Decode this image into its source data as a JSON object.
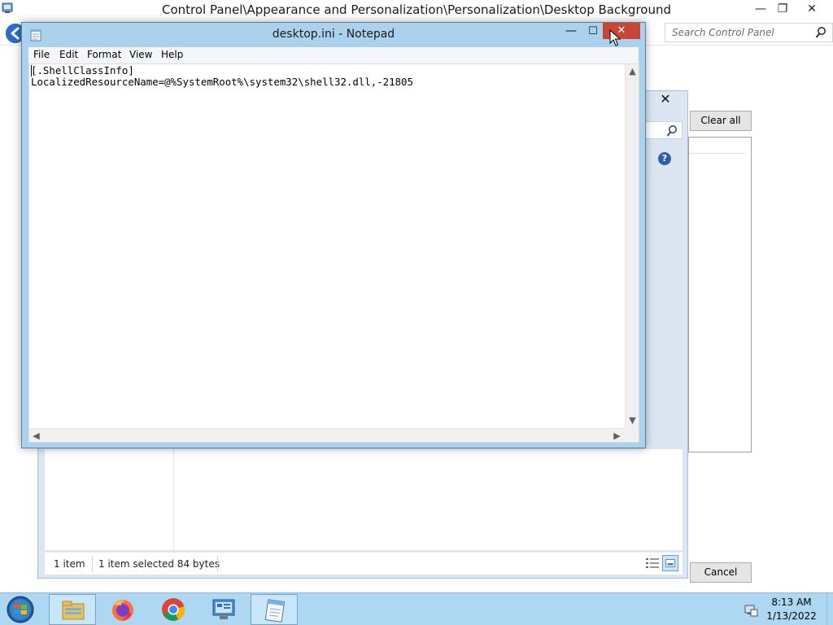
{
  "control_panel": {
    "title": "Control Panel\\Appearance and Personalization\\Personalization\\Desktop Background",
    "minimize_glyph": "—",
    "restore_glyph": "❐",
    "close_glyph": "✕",
    "search_placeholder": "Search Control Panel",
    "clear_all_label": "Clear all",
    "cancel_label": "Cancel"
  },
  "explorer_dialog": {
    "close_glyph": "✕",
    "help_glyph": "?",
    "status": {
      "items": "1 item",
      "selected": "1 item selected  84 bytes"
    }
  },
  "notepad": {
    "title": "desktop.ini - Notepad",
    "minimize_glyph": "—",
    "maximize_glyph": "☐",
    "close_glyph": "✕",
    "menu": [
      "File",
      "Edit",
      "Format",
      "View",
      "Help"
    ],
    "content": "[.ShellClassInfo]\nLocalizedResourceName=@%SystemRoot%\\system32\\shell32.dll,-21805",
    "scroll_up": "▲",
    "scroll_down": "▼",
    "scroll_left": "◀",
    "scroll_right": "▶"
  },
  "taskbar": {
    "clock_time": "8:13 AM",
    "clock_date": "1/13/2022",
    "pinned": [
      "File Explorer",
      "Firefox",
      "Chrome",
      "Control Panel",
      "Notepad"
    ]
  },
  "colors": {
    "notepad_frame": "#aad2ec",
    "close_hover": "#c74735",
    "taskbar": "#aed7f2",
    "back_button": "#2a6fc5"
  },
  "icons": {
    "cp_app": "control-panel-icon",
    "back": "back-arrow-icon",
    "search": "magnifier-icon",
    "help": "help-icon",
    "notepad_app": "notepad-icon",
    "start": "windows-start-icon",
    "tray": "network-icon"
  }
}
